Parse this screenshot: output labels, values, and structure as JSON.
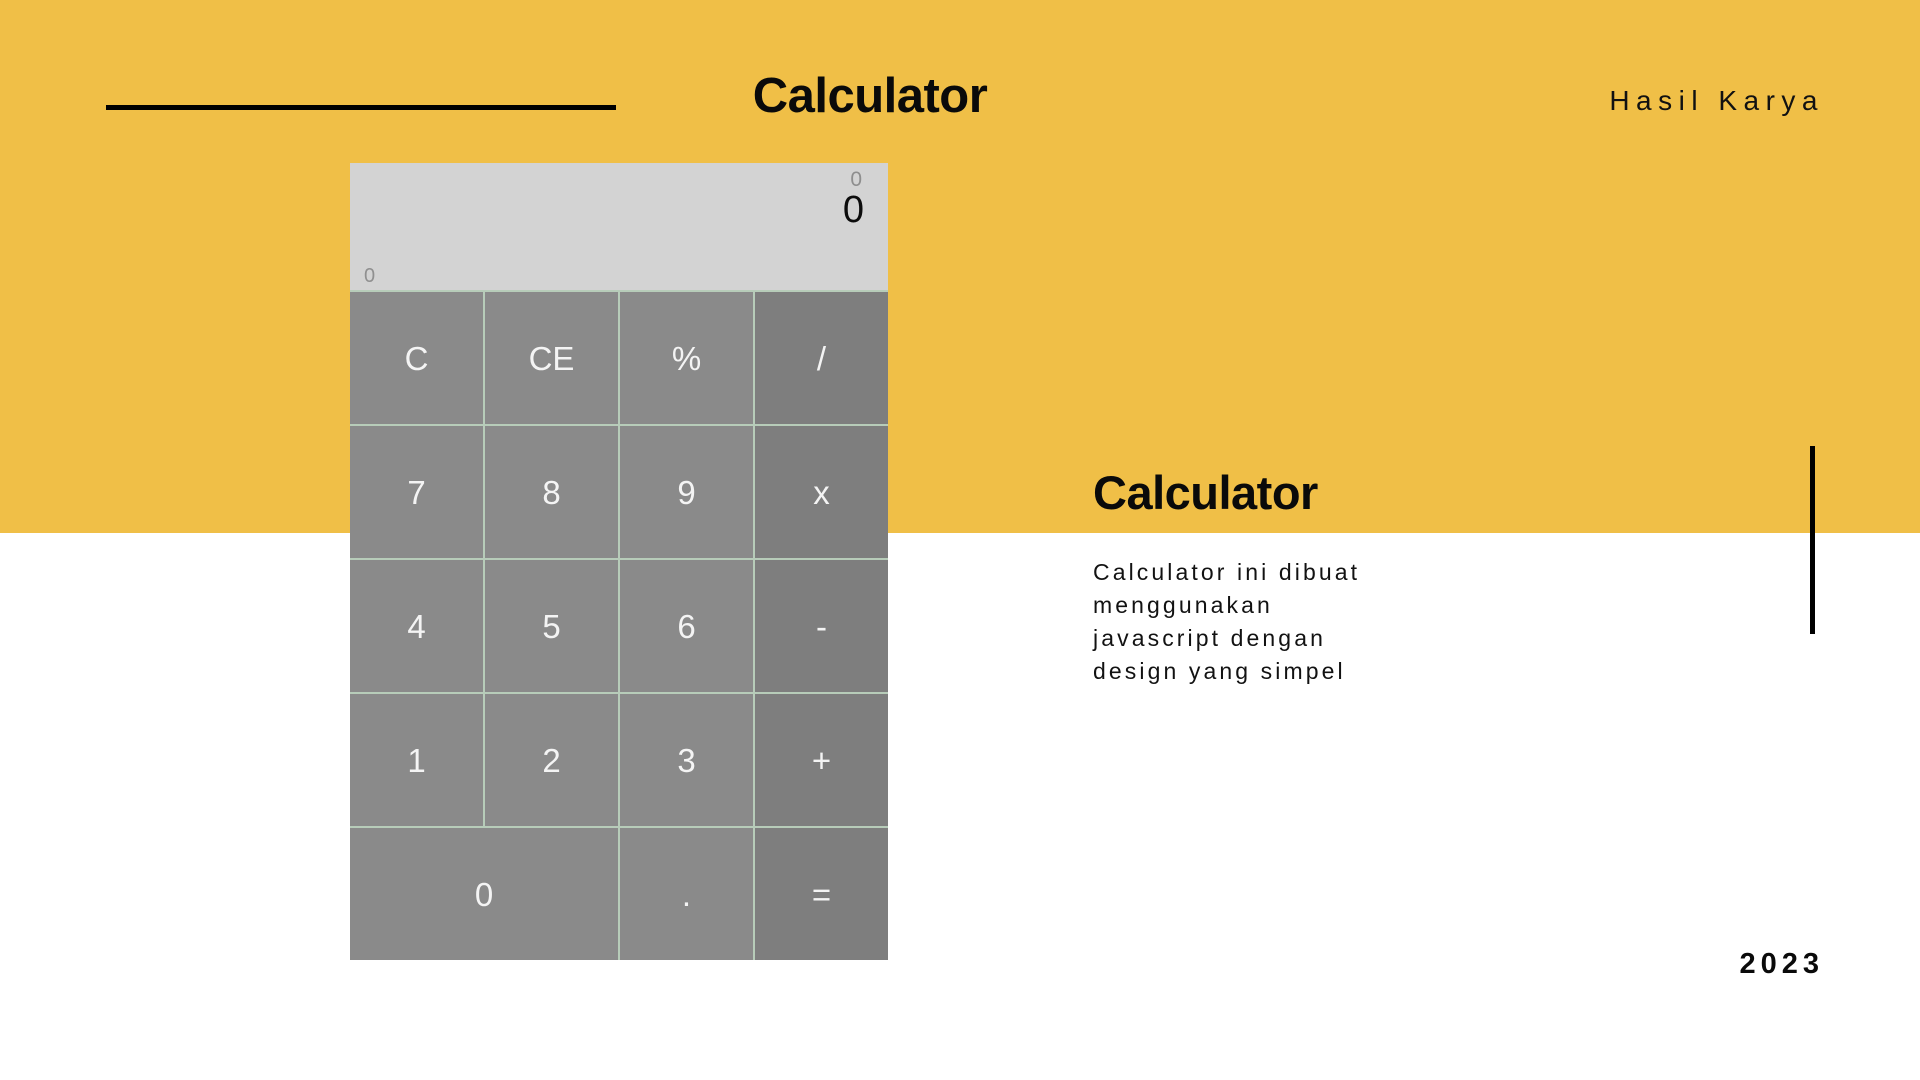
{
  "theme": {
    "accent_yellow": "#f0bf47",
    "page_background": "#ffffff",
    "key_background": "#8a8a8a",
    "key_operator_background": "#7e7e7e",
    "key_text": "#f4f4f4",
    "display_background": "#d3d3d3",
    "grid_line": "#b7ccb9",
    "ink": "#0a0a0a"
  },
  "header": {
    "title": "Calculator",
    "eyebrow": "Hasil Karya"
  },
  "calculator": {
    "display": {
      "history": "0",
      "current": "0",
      "memory": "0"
    },
    "keys": [
      {
        "label": "C",
        "name": "clear",
        "kind": "function"
      },
      {
        "label": "CE",
        "name": "clear-entry",
        "kind": "function"
      },
      {
        "label": "%",
        "name": "percent",
        "kind": "function"
      },
      {
        "label": "/",
        "name": "divide",
        "kind": "operator"
      },
      {
        "label": "7",
        "name": "seven",
        "kind": "digit"
      },
      {
        "label": "8",
        "name": "eight",
        "kind": "digit"
      },
      {
        "label": "9",
        "name": "nine",
        "kind": "digit"
      },
      {
        "label": "x",
        "name": "multiply",
        "kind": "operator"
      },
      {
        "label": "4",
        "name": "four",
        "kind": "digit"
      },
      {
        "label": "5",
        "name": "five",
        "kind": "digit"
      },
      {
        "label": "6",
        "name": "six",
        "kind": "digit"
      },
      {
        "label": "-",
        "name": "subtract",
        "kind": "operator"
      },
      {
        "label": "1",
        "name": "one",
        "kind": "digit"
      },
      {
        "label": "2",
        "name": "two",
        "kind": "digit"
      },
      {
        "label": "3",
        "name": "three",
        "kind": "digit"
      },
      {
        "label": "+",
        "name": "add",
        "kind": "operator"
      },
      {
        "label": "0",
        "name": "zero",
        "kind": "digit",
        "wide": true
      },
      {
        "label": ".",
        "name": "decimal-point",
        "kind": "digit"
      },
      {
        "label": "=",
        "name": "equals",
        "kind": "operator"
      }
    ]
  },
  "description": {
    "title": "Calculator",
    "body_lines": [
      "Calculator ini dibuat",
      "menggunakan",
      "javascript dengan",
      "design yang simpel"
    ]
  },
  "footer": {
    "year": "2023"
  }
}
